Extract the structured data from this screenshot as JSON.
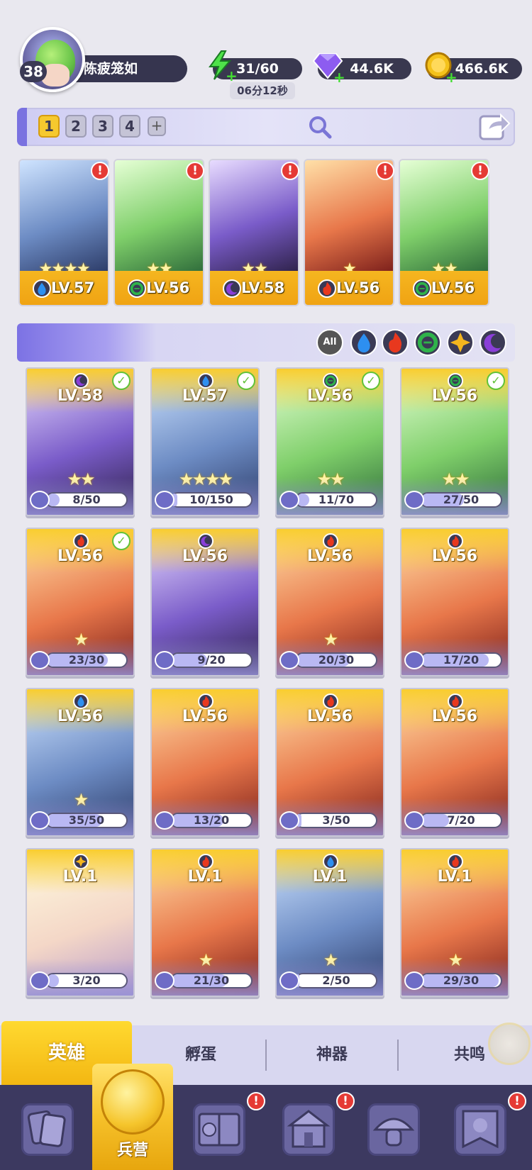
{
  "player": {
    "level": "38",
    "name": "陈疲笼如"
  },
  "resources": {
    "energy": "31/60",
    "energy_timer": "06分12秒",
    "gems": "44.6K",
    "gold": "466.6K"
  },
  "team_tabs": [
    "1",
    "2",
    "3",
    "4"
  ],
  "team_add": "+",
  "team_heroes": [
    {
      "level": "LV.57",
      "stars": "★★★★",
      "element": "water",
      "alert": "!"
    },
    {
      "level": "LV.56",
      "stars": "★★",
      "element": "nature",
      "alert": "!"
    },
    {
      "level": "LV.58",
      "stars": "★★",
      "element": "dark",
      "alert": "!"
    },
    {
      "level": "LV.56",
      "stars": "★",
      "element": "fire",
      "alert": "!"
    },
    {
      "level": "LV.56",
      "stars": "★★",
      "element": "nature",
      "alert": "!"
    }
  ],
  "filters": {
    "all_label": "All",
    "elements": [
      "water",
      "fire",
      "nature",
      "light",
      "dark"
    ]
  },
  "heroes": [
    {
      "level": "LV.58",
      "element": "dark",
      "stars": "★★",
      "shards": "8/50",
      "fill": 0.16,
      "in_team": true
    },
    {
      "level": "LV.57",
      "element": "water",
      "stars": "★★★★",
      "shards": "10/150",
      "fill": 0.07,
      "in_team": true
    },
    {
      "level": "LV.56",
      "element": "nature",
      "stars": "★★",
      "shards": "11/70",
      "fill": 0.16,
      "in_team": true
    },
    {
      "level": "LV.56",
      "element": "nature",
      "stars": "★★",
      "shards": "27/50",
      "fill": 0.54,
      "in_team": true
    },
    {
      "level": "LV.56",
      "element": "fire",
      "stars": "★",
      "shards": "23/30",
      "fill": 0.77,
      "in_team": true
    },
    {
      "level": "LV.56",
      "element": "dark",
      "stars": "",
      "shards": "9/20",
      "fill": 0.45,
      "in_team": false
    },
    {
      "level": "LV.56",
      "element": "fire",
      "stars": "★",
      "shards": "20/30",
      "fill": 0.67,
      "in_team": false
    },
    {
      "level": "LV.56",
      "element": "fire",
      "stars": "",
      "shards": "17/20",
      "fill": 0.85,
      "in_team": false
    },
    {
      "level": "LV.56",
      "element": "water",
      "stars": "★",
      "shards": "35/50",
      "fill": 0.7,
      "in_team": false
    },
    {
      "level": "LV.56",
      "element": "fire",
      "stars": "",
      "shards": "13/20",
      "fill": 0.65,
      "in_team": false
    },
    {
      "level": "LV.56",
      "element": "fire",
      "stars": "",
      "shards": "3/50",
      "fill": 0.06,
      "in_team": false
    },
    {
      "level": "LV.56",
      "element": "fire",
      "stars": "",
      "shards": "7/20",
      "fill": 0.35,
      "in_team": false
    },
    {
      "level": "LV.1",
      "element": "light",
      "stars": "",
      "shards": "3/20",
      "fill": 0.15,
      "in_team": false
    },
    {
      "level": "LV.1",
      "element": "fire",
      "stars": "★",
      "shards": "21/30",
      "fill": 0.7,
      "in_team": false
    },
    {
      "level": "LV.1",
      "element": "water",
      "stars": "★",
      "shards": "2/50",
      "fill": 0.04,
      "in_team": false
    },
    {
      "level": "LV.1",
      "element": "fire",
      "stars": "★",
      "shards": "29/30",
      "fill": 0.97,
      "in_team": false
    }
  ],
  "sub_tabs": [
    "英雄",
    "孵蛋",
    "神器",
    "共鸣"
  ],
  "bottom_nav": {
    "active_label": "兵营",
    "alert": "!"
  },
  "colors": {
    "water": "#2d8ff0",
    "fire": "#e8381e",
    "nature": "#2fb34a",
    "light": "#f3b51e",
    "dark": "#8a3fd8",
    "accent_gold": "#f6c12a",
    "panel": "#d8d7f0"
  }
}
